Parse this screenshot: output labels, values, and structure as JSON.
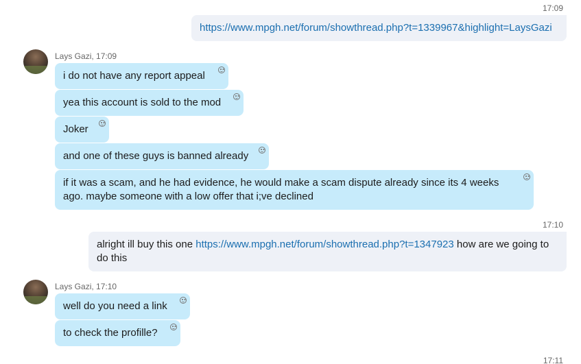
{
  "timestamps": {
    "t1": "17:09",
    "t2": "17:10",
    "t3": "17:11"
  },
  "outgoing": {
    "msg1": "https://www.mpgh.net/forum/showthread.php?t=1339967&highlight=LaysGazi",
    "msg2_before": "alright ill buy this one ",
    "msg2_link": "https://www.mpgh.net/forum/showthread.php?t=1347923",
    "msg2_after": " how are we going to do this"
  },
  "group1": {
    "sender": "Lays Gazi",
    "time": "17:09",
    "messages": [
      "i do not have any report appeal",
      "yea this account is sold to the mod",
      "Joker",
      "and one of these guys is banned already",
      "if it was a scam, and he had evidence, he would make a scam dispute already since its 4 weeks ago. maybe someone with a low offer that i;ve declined"
    ]
  },
  "group2": {
    "sender": "Lays Gazi",
    "time": "17:10",
    "messages": [
      "well do you need a link",
      "to check the profille?"
    ]
  },
  "icons": {
    "reaction": "smiley-icon",
    "avatar": "avatar"
  }
}
